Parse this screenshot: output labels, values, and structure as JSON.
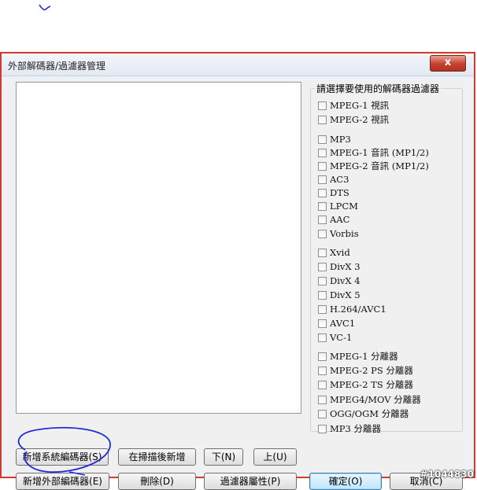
{
  "window": {
    "title": "外部解碼器/過濾器管理",
    "close_label": "x"
  },
  "filters_group": {
    "legend": "請選擇要使用的解碼器過濾器",
    "items": [
      {
        "label": "MPEG-1 視訊",
        "checked": false
      },
      {
        "label": "MPEG-2 視訊",
        "checked": false
      },
      {
        "label": "MP3",
        "checked": false
      },
      {
        "label": "MPEG-1 音訊 (MP1/2)",
        "checked": false
      },
      {
        "label": "MPEG-2 音訊 (MP1/2)",
        "checked": false
      },
      {
        "label": "AC3",
        "checked": false
      },
      {
        "label": "DTS",
        "checked": false
      },
      {
        "label": "LPCM",
        "checked": false
      },
      {
        "label": "AAC",
        "checked": false
      },
      {
        "label": "Vorbis",
        "checked": false
      },
      {
        "label": "Xvid",
        "checked": false
      },
      {
        "label": "DivX 3",
        "checked": false
      },
      {
        "label": "DivX 4",
        "checked": false
      },
      {
        "label": "DivX 5",
        "checked": false
      },
      {
        "label": "H.264/AVC1",
        "checked": false
      },
      {
        "label": "AVC1",
        "checked": false
      },
      {
        "label": "VC-1",
        "checked": false
      },
      {
        "label": "MPEG-1 分離器",
        "checked": false
      },
      {
        "label": "MPEG-2 PS 分離器",
        "checked": false
      },
      {
        "label": "MPEG-2 TS 分離器",
        "checked": false
      },
      {
        "label": "MPEG4/MOV 分離器",
        "checked": false
      },
      {
        "label": "OGG/OGM 分離器",
        "checked": false
      },
      {
        "label": "MP3 分離器",
        "checked": false
      }
    ]
  },
  "buttons": {
    "add_system_codec": "新增系統編碼器(S)",
    "add_after_scan": "在掃描後新增",
    "down": "下(N)",
    "up": "上(U)",
    "add_external_codec": "新增外部編碼器(E)",
    "delete": "刪除(D)",
    "filter_properties": "過濾器屬性(P)",
    "ok": "確定(O)",
    "cancel": "取消(C)"
  },
  "watermark": "#1044830",
  "colors": {
    "window_border": "#d23a2c",
    "annotation_ink": "#1e2bd6"
  }
}
